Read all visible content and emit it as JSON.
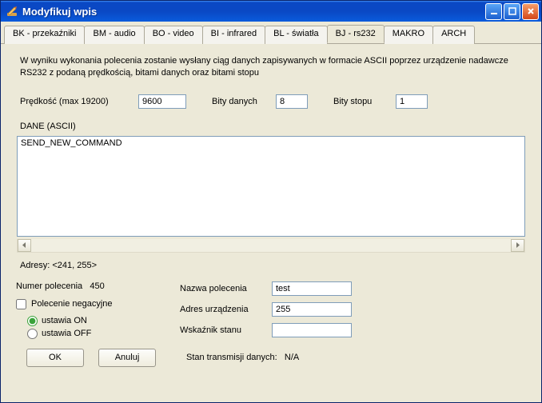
{
  "window": {
    "title": "Modyfikuj wpis"
  },
  "tabs": [
    {
      "label": "BK - przekaźniki"
    },
    {
      "label": "BM - audio"
    },
    {
      "label": "BO - video"
    },
    {
      "label": "BI - infrared"
    },
    {
      "label": "BL - światła"
    },
    {
      "label": "BJ - rs232",
      "active": true
    },
    {
      "label": "MAKRO"
    },
    {
      "label": "ARCH"
    }
  ],
  "description": "W wyniku wykonania polecenia zostanie wysłany ciąg danych zapisywanych w formacie ASCII poprzez urządzenie nadawcze RS232 z podaną prędkością, bitami danych oraz bitami stopu",
  "fields": {
    "speed_label": "Prędkość (max 19200)",
    "speed_value": "9600",
    "databits_label": "Bity danych",
    "databits_value": "8",
    "stopbits_label": "Bity stopu",
    "stopbits_value": "1",
    "data_label": "DANE (ASCII)",
    "data_value": "SEND_NEW_COMMAND",
    "addresses_label": "Adresy: <241, 255>",
    "cmdnum_label": "Numer polecenia",
    "cmdnum_value": "450",
    "negation_label": "Polecenie negacyjne",
    "set_on_label": "ustawia ON",
    "set_off_label": "ustawia OFF",
    "name_label": "Nazwa polecenia",
    "name_value": "test",
    "devaddr_label": "Adres urządzenia",
    "devaddr_value": "255",
    "status_label": "Wskaźnik stanu",
    "status_value": "",
    "tx_status_label": "Stan transmisji danych:",
    "tx_status_value": "N/A"
  },
  "buttons": {
    "ok": "OK",
    "cancel": "Anuluj"
  }
}
